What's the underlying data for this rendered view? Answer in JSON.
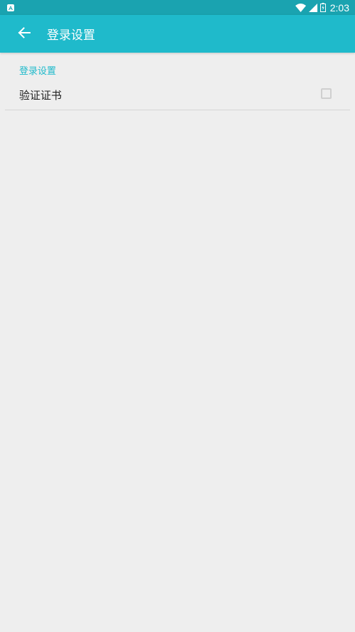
{
  "status_bar": {
    "time": "2:03",
    "icons": [
      "notification-a-icon",
      "wifi-icon",
      "signal-icon",
      "battery-charging-icon"
    ]
  },
  "app_bar": {
    "title": "登录设置",
    "back_icon": "arrow-back-icon"
  },
  "settings": {
    "section_header": "登录设置",
    "items": [
      {
        "title": "验证证书",
        "checked": false
      }
    ]
  },
  "colors": {
    "status_bar": "#1aa3b0",
    "app_bar": "#1fbacb",
    "accent": "#1fbacb",
    "background": "#eeeeee"
  }
}
